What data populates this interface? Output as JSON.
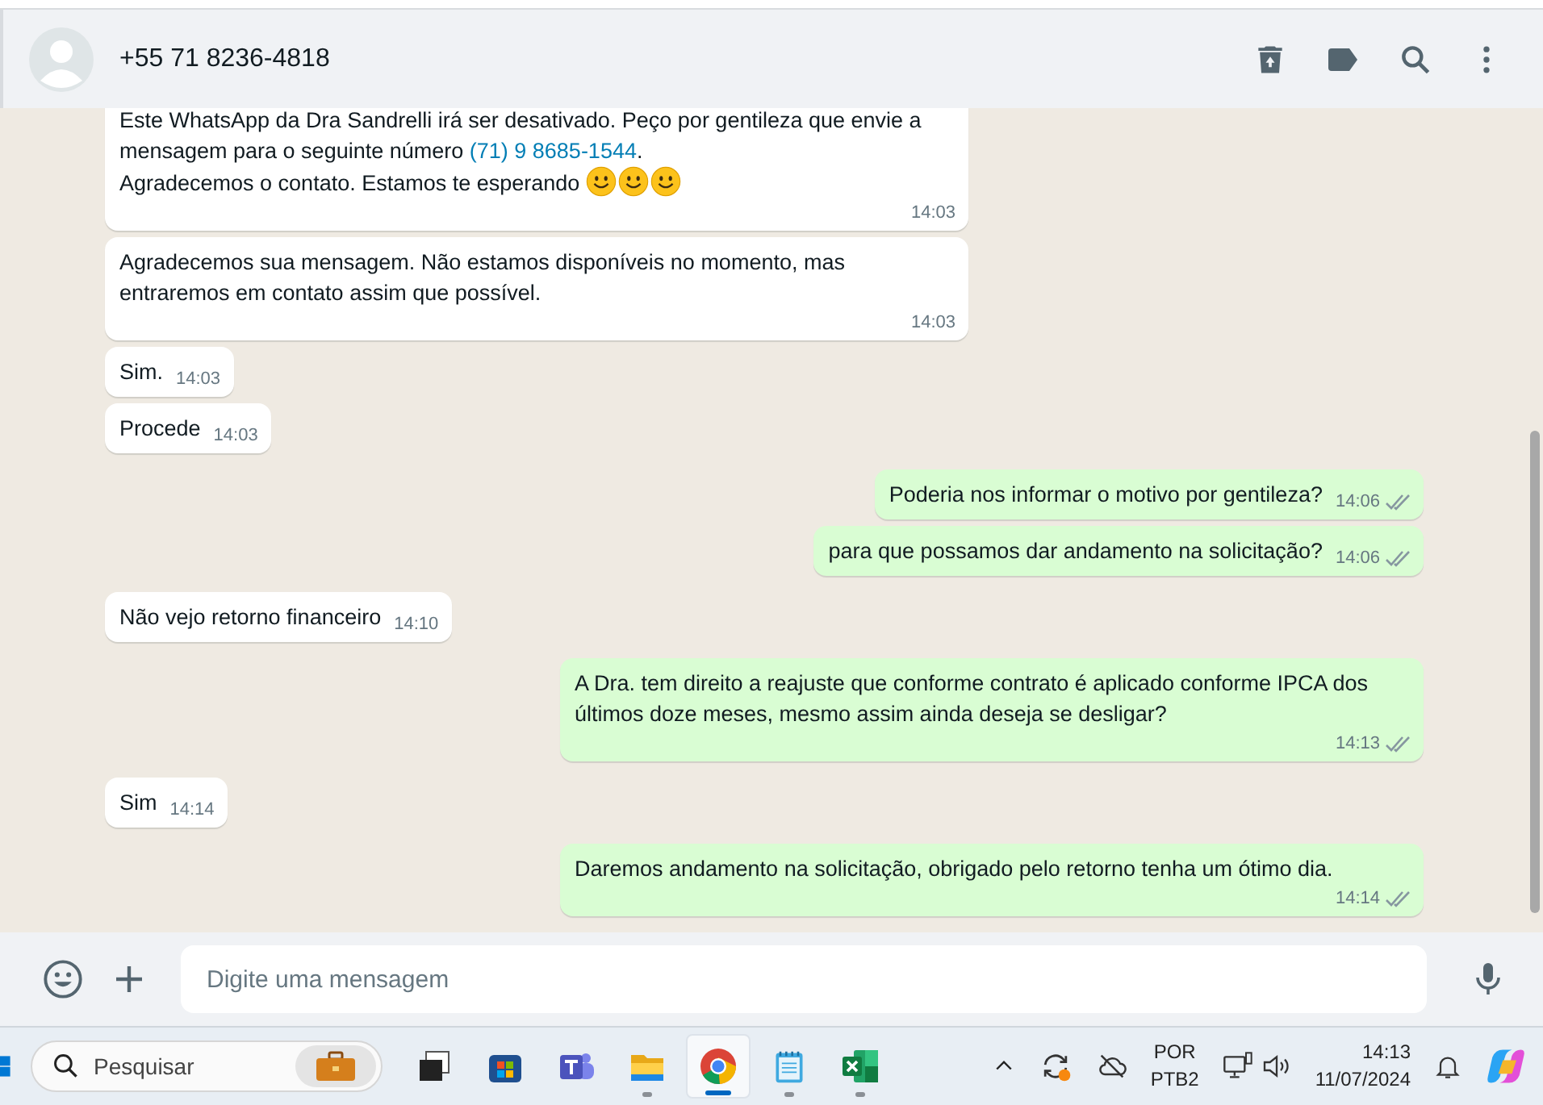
{
  "header": {
    "contact": "+55 71 8236-4818"
  },
  "messages": [
    {
      "outgoing": false,
      "time": "14:03",
      "parts": [
        {
          "kind": "text",
          "text": "Este WhatsApp da Dra Sandrelli irá ser desativado. Peço por gentileza que envie a mensagem para o seguinte número "
        },
        {
          "kind": "link",
          "text": "(71) 9 8685-1544"
        },
        {
          "kind": "text",
          "text": ".\nAgradecemos o contato. Estamos te esperando "
        },
        {
          "kind": "emoji"
        },
        {
          "kind": "emoji"
        },
        {
          "kind": "emoji"
        }
      ]
    },
    {
      "outgoing": false,
      "time": "14:03",
      "parts": [
        {
          "kind": "text",
          "text": "Agradecemos sua mensagem. Não estamos disponíveis no momento, mas entraremos em contato assim que possível."
        }
      ]
    },
    {
      "outgoing": false,
      "time": "14:03",
      "parts": [
        {
          "kind": "text",
          "text": "Sim."
        }
      ]
    },
    {
      "outgoing": false,
      "time": "14:03",
      "parts": [
        {
          "kind": "text",
          "text": "Procede"
        }
      ]
    },
    {
      "outgoing": true,
      "time": "14:06",
      "read": false,
      "parts": [
        {
          "kind": "text",
          "text": "Poderia nos informar o motivo por gentileza?"
        }
      ]
    },
    {
      "outgoing": true,
      "time": "14:06",
      "read": false,
      "parts": [
        {
          "kind": "text",
          "text": "para que possamos dar andamento na solicitação?"
        }
      ]
    },
    {
      "outgoing": false,
      "time": "14:10",
      "parts": [
        {
          "kind": "text",
          "text": "Não vejo retorno financeiro"
        }
      ]
    },
    {
      "outgoing": true,
      "time": "14:13",
      "read": false,
      "parts": [
        {
          "kind": "text",
          "text": "A Dra. tem direito a reajuste que conforme contrato é aplicado conforme IPCA dos últimos doze meses, mesmo assim ainda deseja se desligar?"
        }
      ]
    },
    {
      "outgoing": false,
      "time": "14:14",
      "parts": [
        {
          "kind": "text",
          "text": "Sim"
        }
      ]
    },
    {
      "outgoing": true,
      "time": "14:14",
      "read": false,
      "parts": [
        {
          "kind": "text",
          "text": "Daremos andamento na solicitação, obrigado pelo retorno tenha um ótimo dia."
        }
      ]
    }
  ],
  "composer": {
    "placeholder": "Digite uma mensagem"
  },
  "taskbar": {
    "search": {
      "placeholder": "Pesquisar"
    },
    "apps": [
      {
        "kind": "task-view",
        "running": false,
        "selected": false
      },
      {
        "kind": "store",
        "running": false,
        "selected": false
      },
      {
        "kind": "teams",
        "running": false,
        "selected": false
      },
      {
        "kind": "files",
        "running": true,
        "selected": false
      },
      {
        "kind": "browser",
        "running": true,
        "selected": true
      },
      {
        "kind": "notepad",
        "running": true,
        "selected": false
      },
      {
        "kind": "excel",
        "running": true,
        "selected": false
      }
    ],
    "language": {
      "code": "POR",
      "layout": "PTB2"
    },
    "clock": {
      "time": "14:13",
      "date": "11/07/2024"
    }
  }
}
